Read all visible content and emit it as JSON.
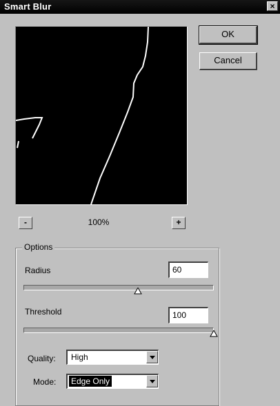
{
  "window": {
    "title": "Smart Blur",
    "close_label": "×"
  },
  "buttons": {
    "ok": "OK",
    "cancel": "Cancel"
  },
  "preview": {
    "zoom_out_label": "-",
    "zoom_in_label": "+",
    "zoom_level": "100%"
  },
  "options": {
    "group_label": "Options",
    "radius_label": "Radius",
    "radius_value": "60",
    "radius_slider_fraction": 0.6,
    "threshold_label": "Threshold",
    "threshold_value": "100",
    "threshold_slider_fraction": 1.0,
    "quality_label": "Quality:",
    "quality_value": "High",
    "mode_label": "Mode:",
    "mode_value": "Edge Only"
  },
  "icons": {
    "close": "close-icon",
    "dropdown": "chevron-down-icon",
    "slider_thumb": "triangle-up-icon"
  },
  "colors": {
    "dialog_background": "#c0c0c0",
    "preview_background": "#000000",
    "edge_lines": "#ffffff"
  }
}
